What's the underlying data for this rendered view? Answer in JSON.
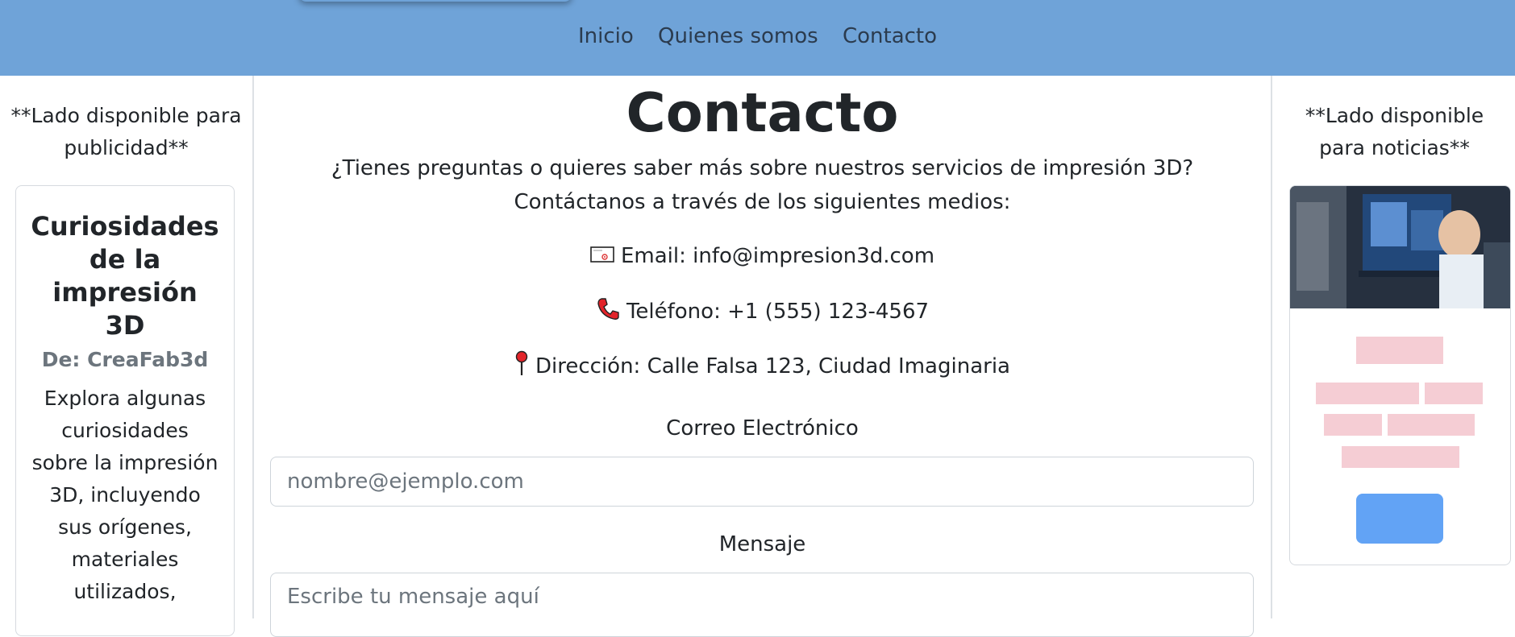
{
  "nav": {
    "items": [
      "Inicio",
      "Quienes somos",
      "Contacto"
    ]
  },
  "left_sidebar": {
    "note": "**Lado disponible para publicidad**",
    "card": {
      "title": "Curiosidades de la impresión 3D",
      "subtitle": "De: CreaFab3d",
      "text": "Explora algunas curiosidades sobre la impresión 3D, incluyendo sus orígenes, materiales utilizados,"
    }
  },
  "main": {
    "title": "Contacto",
    "intro": "¿Tienes preguntas o quieres saber más sobre nuestros servicios de impresión 3D? Contáctanos a través de los siguientes medios:",
    "email": "Email: info@impresion3d.com",
    "phone": "Teléfono: +1 (555) 123-4567",
    "address": "Dirección: Calle Falsa 123, Ciudad Imaginaria",
    "form": {
      "email_label": "Correo Electrónico",
      "email_placeholder": "nombre@ejemplo.com",
      "message_label": "Mensaje",
      "message_placeholder": "Escribe tu mensaje aquí"
    }
  },
  "right_sidebar": {
    "note": "**Lado disponible para noticias**"
  },
  "icons": {
    "email": "envelope-icon",
    "phone": "telephone-icon",
    "address": "pushpin-icon"
  },
  "colors": {
    "navbar": "#6fa3d8",
    "placeholder_text": "#f5cdd4",
    "placeholder_button": "#62a3f5"
  }
}
